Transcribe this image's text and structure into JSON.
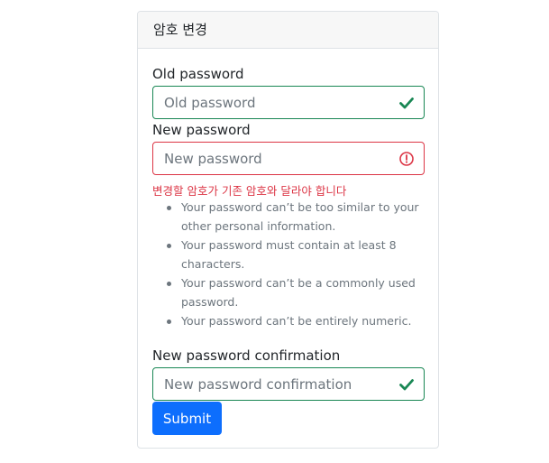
{
  "card": {
    "header_title": "암호 변경"
  },
  "form": {
    "old_password": {
      "label": "Old password",
      "placeholder": "Old password",
      "state": "valid"
    },
    "new_password": {
      "label": "New password",
      "placeholder": "New password",
      "state": "invalid",
      "error": "변경할 암호가 기존 암호와 달라야 합니다",
      "help_items": [
        "Your password can’t be too similar to your other personal information.",
        "Your password must contain at least 8 characters.",
        "Your password can’t be a commonly used password.",
        "Your password can’t be entirely numeric."
      ]
    },
    "new_password_confirmation": {
      "label": "New password confirmation",
      "placeholder": "New password confirmation",
      "state": "valid"
    },
    "submit_label": "Submit"
  },
  "colors": {
    "valid": "#198754",
    "invalid": "#dc3545",
    "primary": "#0d6efd",
    "muted": "#6c757d"
  }
}
